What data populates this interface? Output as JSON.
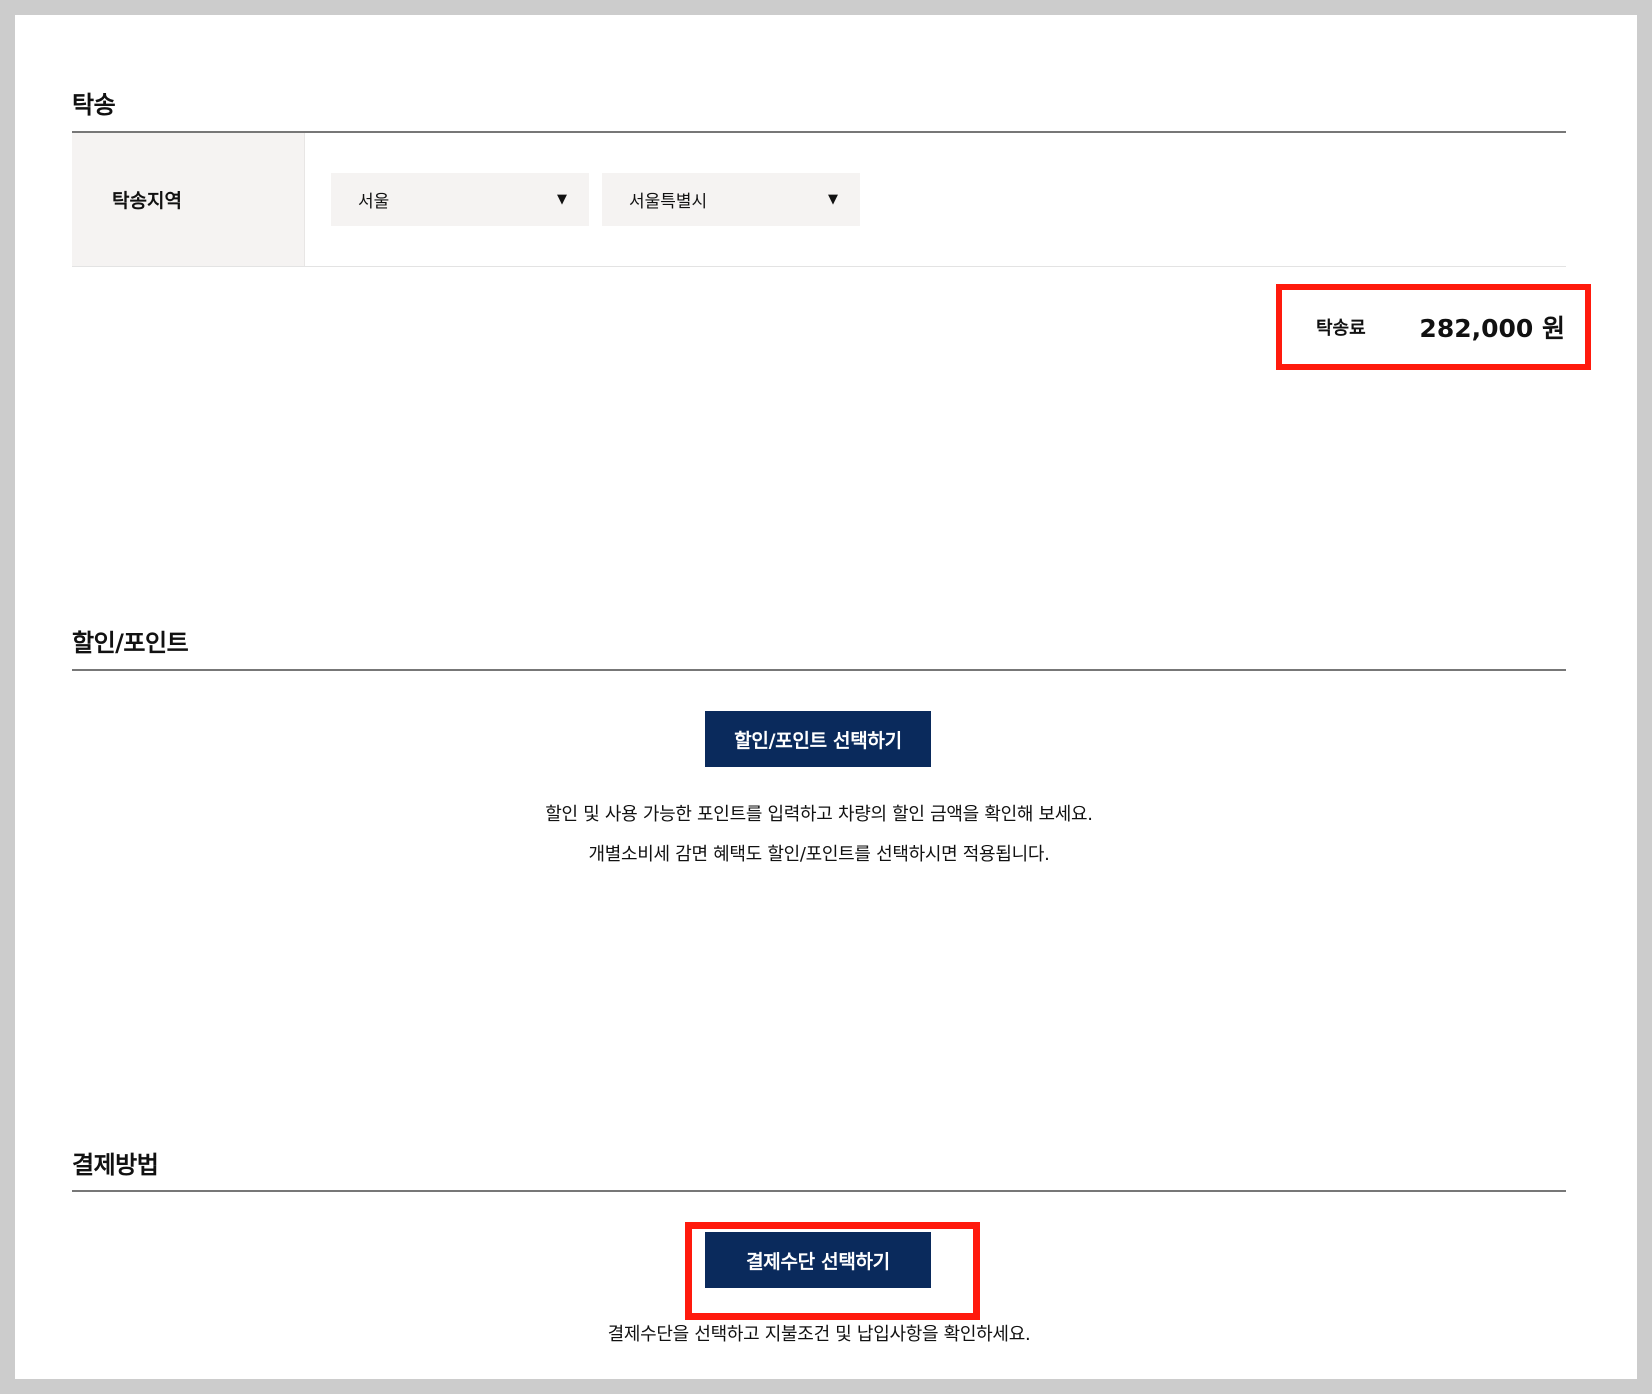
{
  "delivery": {
    "title": "탁송",
    "region_label": "탁송지역",
    "region_primary": "서울",
    "region_secondary": "서울특별시",
    "fee_label": "탁송료",
    "fee_value": "282,000 원"
  },
  "discount": {
    "title": "할인/포인트",
    "button_label": "할인/포인트 선택하기",
    "desc_line1": "할인 및 사용 가능한 포인트를 입력하고 차량의 할인 금액을 확인해 보세요.",
    "desc_line2": "개별소비세 감면 혜택도 할인/포인트를 선택하시면 적용됩니다."
  },
  "payment": {
    "title": "결제방법",
    "button_label": "결제수단 선택하기",
    "desc": "결제수단을 선택하고 지불조건 및 납입사항을 확인하세요."
  },
  "icons": {
    "dropdown": "chevron-down-icon"
  },
  "colors": {
    "button_bg": "#0a2a5c",
    "highlight": "#ff1a0d",
    "select_bg": "#f5f3f2"
  }
}
